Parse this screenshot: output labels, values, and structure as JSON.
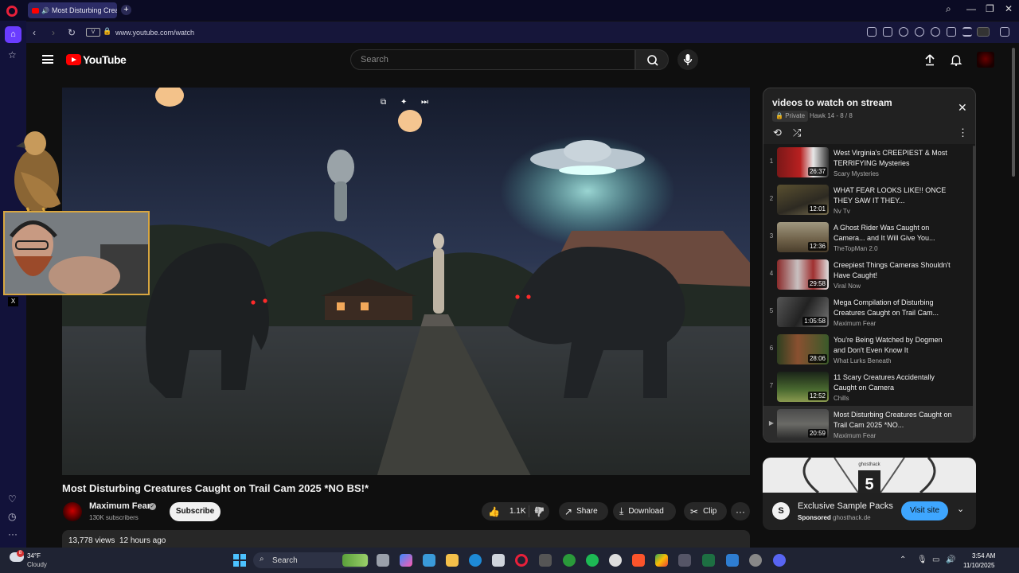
{
  "browser": {
    "tab_title": "Most Disturbing Creat",
    "address_badge": "V",
    "url": "www.youtube.com/watch"
  },
  "youtube": {
    "logo_text": "YouTube",
    "search_placeholder": "Search"
  },
  "video": {
    "title": "Most Disturbing Creatures Caught on Trail Cam 2025 *NO BS!*",
    "channel": "Maximum Fear",
    "subscribers": "130K subscribers",
    "subscribe_label": "Subscribe",
    "likes": "1.1K",
    "share_label": "Share",
    "download_label": "Download",
    "clip_label": "Clip",
    "views": "13,778 views",
    "age": "12 hours ago"
  },
  "playlist": {
    "title": "videos to watch on stream",
    "privacy": "Private",
    "meta": "Hawk 14 - 8 / 8",
    "items": [
      {
        "index": "1",
        "title": "West Virginia's CREEPIEST & Most TERRIFYING Mysteries",
        "channel": "Scary Mysteries",
        "duration": "26:37"
      },
      {
        "index": "2",
        "title": "WHAT FEAR LOOKS LIKE!! ONCE THEY SAW IT THEY...",
        "channel": "Nv Tv",
        "duration": "12:01"
      },
      {
        "index": "3",
        "title": "A Ghost Rider Was Caught on Camera... and It Will Give You...",
        "channel": "TheTopMan 2.0",
        "duration": "12:36"
      },
      {
        "index": "4",
        "title": "Creepiest Things Cameras Shouldn't Have Caught!",
        "channel": "Viral Now",
        "duration": "29:58"
      },
      {
        "index": "5",
        "title": "Mega Compilation of Disturbing Creatures Caught on Trail Cam...",
        "channel": "Maximum Fear",
        "duration": "1:05:58"
      },
      {
        "index": "6",
        "title": "You're Being Watched by Dogmen and Don't Even Know It",
        "channel": "What Lurks Beneath",
        "duration": "28:06"
      },
      {
        "index": "7",
        "title": "11 Scary Creatures Accidentally Caught on Camera",
        "channel": "Chills",
        "duration": "12:52"
      },
      {
        "index": "▶",
        "title": "Most Disturbing Creatures Caught on Trail Cam 2025 *NO...",
        "channel": "Maximum Fear",
        "duration": "20:59"
      }
    ]
  },
  "ad": {
    "title": "Exclusive Sample Packs",
    "sponsored": "Sponsored",
    "domain": "ghosthack.de",
    "visit_label": "Visit site",
    "banner_text": "ghosthack"
  },
  "taskbar": {
    "weather_temp": "34°F",
    "weather_desc": "Cloudy",
    "weather_badge": "8",
    "search_label": "Search",
    "time": "3:54 AM",
    "date": "11/10/2025"
  },
  "colors": {
    "yt_red": "#ff0000",
    "accent_blue": "#3ea6ff",
    "browser_accent": "#6a3cff"
  }
}
